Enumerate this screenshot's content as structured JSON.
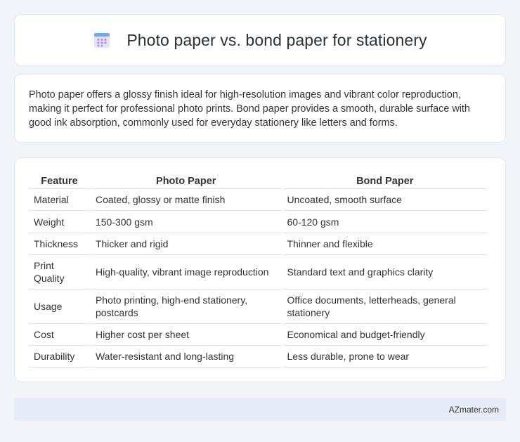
{
  "header": {
    "icon": "calendar-grid-icon",
    "title": "Photo paper vs. bond paper for stationery"
  },
  "intro": {
    "text": "Photo paper offers a glossy finish ideal for high-resolution images and vibrant color reproduction, making it perfect for professional photo prints. Bond paper provides a smooth, durable surface with good ink absorption, commonly used for everyday stationery like letters and forms."
  },
  "table": {
    "headers": [
      "Feature",
      "Photo Paper",
      "Bond Paper"
    ],
    "rows": [
      [
        "Material",
        "Coated, glossy or matte finish",
        "Uncoated, smooth surface"
      ],
      [
        "Weight",
        "150-300 gsm",
        "60-120 gsm"
      ],
      [
        "Thickness",
        "Thicker and rigid",
        "Thinner and flexible"
      ],
      [
        "Print Quality",
        "High-quality, vibrant image reproduction",
        "Standard text and graphics clarity"
      ],
      [
        "Usage",
        "Photo printing, high-end stationery, postcards",
        "Office documents, letterheads, general stationery"
      ],
      [
        "Cost",
        "Higher cost per sheet",
        "Economical and budget-friendly"
      ],
      [
        "Durability",
        "Water-resistant and long-lasting",
        "Less durable, prone to wear"
      ]
    ]
  },
  "footer": {
    "brand": "AZmater.com"
  },
  "colors": {
    "background": "#f1f4f9",
    "card": "#ffffff",
    "footer": "#e6edf8",
    "icon_blue": "#6ea8f0",
    "icon_purple": "#b48ede"
  }
}
